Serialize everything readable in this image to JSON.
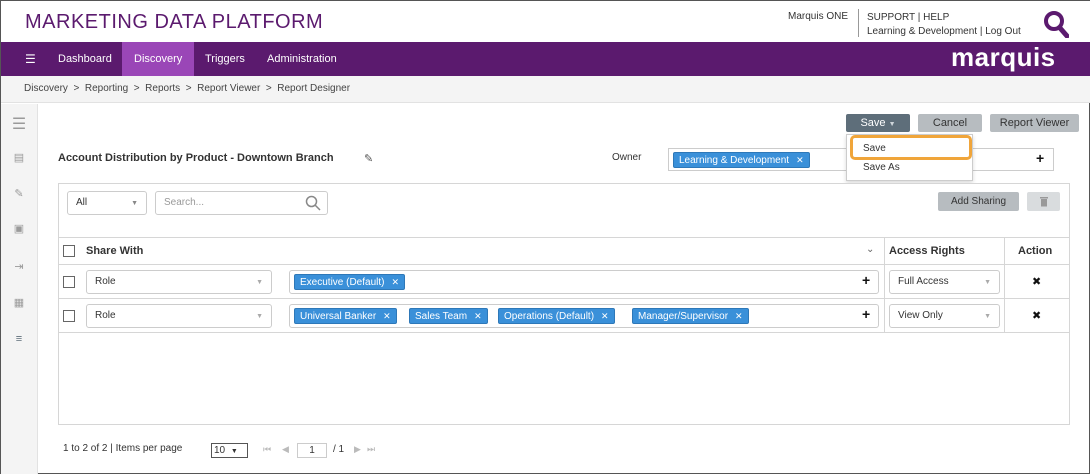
{
  "header": {
    "app_title": "MARKETING DATA PLATFORM",
    "user": "Marquis ONE",
    "support": "SUPPORT | HELP",
    "links": "Learning & Development | Log Out",
    "brand": "marquis"
  },
  "nav": {
    "items": [
      {
        "label": "Dashboard",
        "active": false
      },
      {
        "label": "Discovery",
        "active": true
      },
      {
        "label": "Triggers",
        "active": false
      },
      {
        "label": "Administration",
        "active": false
      }
    ]
  },
  "breadcrumb": "Discovery  >  Reporting  >  Reports  >  Report Viewer  >  Report Designer",
  "toolbar": {
    "save": "Save",
    "cancel": "Cancel",
    "report_viewer": "Report Viewer"
  },
  "save_menu": {
    "items": [
      "Save",
      "Save As"
    ]
  },
  "report": {
    "title": "Account Distribution by Product - Downtown Branch",
    "owner_label": "Owner",
    "owner_tag": "Learning & Development"
  },
  "filter": {
    "scope": "All",
    "search_placeholder": "Search..."
  },
  "actions": {
    "add_sharing": "Add Sharing"
  },
  "grid": {
    "headers": {
      "share_with": "Share With",
      "access_rights": "Access Rights",
      "action": "Action"
    },
    "rows": [
      {
        "type": "Role",
        "tags": [
          "Executive (Default)"
        ],
        "access": "Full Access"
      },
      {
        "type": "Role",
        "tags": [
          "Universal Banker",
          "Sales Team",
          "Operations (Default)",
          "Manager/Supervisor"
        ],
        "access": "View Only"
      }
    ]
  },
  "pager": {
    "summary": "1 to 2 of 2 | Items per page",
    "per_page": "10",
    "page": "1",
    "total": "/ 1"
  },
  "colors": {
    "brand_purple": "#5b1a6e",
    "active_tab": "#9a46b7",
    "tag_blue": "#3a90d9",
    "highlight": "#f0a53a"
  }
}
